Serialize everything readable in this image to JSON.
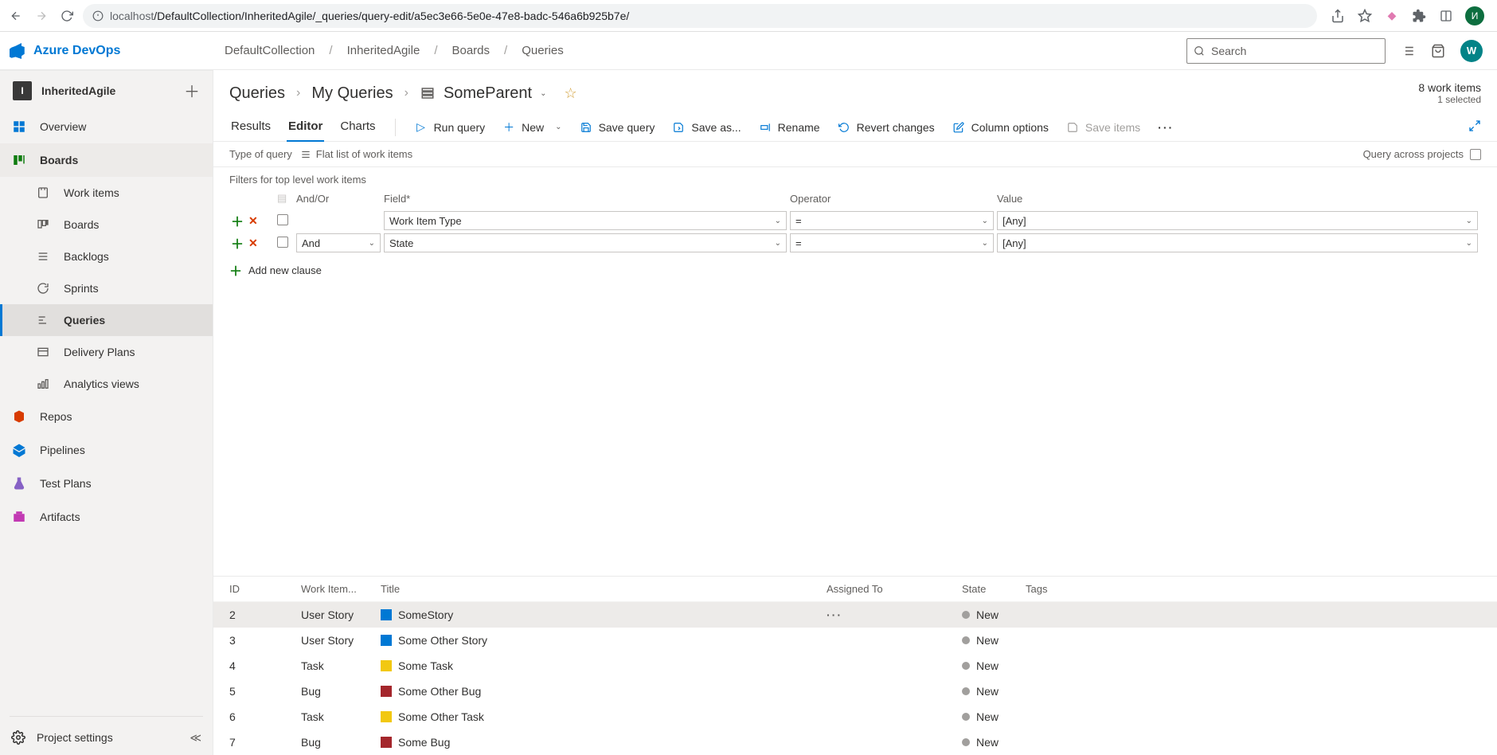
{
  "browser": {
    "url_host": "localhost",
    "url_path": "/DefaultCollection/InheritedAgile/_queries/query-edit/a5ec3e66-5e0e-47e8-badc-546a6b925b7e/",
    "avatar_initial": "И"
  },
  "suite": {
    "product": "Azure DevOps",
    "crumbs": [
      "DefaultCollection",
      "InheritedAgile",
      "Boards",
      "Queries"
    ],
    "search_placeholder": "Search",
    "avatar_initial": "W"
  },
  "sidebar": {
    "project_name": "InheritedAgile",
    "project_initial": "I",
    "items": [
      {
        "label": "Overview"
      },
      {
        "label": "Boards"
      },
      {
        "label": "Work items"
      },
      {
        "label": "Boards"
      },
      {
        "label": "Backlogs"
      },
      {
        "label": "Sprints"
      },
      {
        "label": "Queries"
      },
      {
        "label": "Delivery Plans"
      },
      {
        "label": "Analytics views"
      },
      {
        "label": "Repos"
      },
      {
        "label": "Pipelines"
      },
      {
        "label": "Test Plans"
      },
      {
        "label": "Artifacts"
      }
    ],
    "footer": "Project settings"
  },
  "query_header": {
    "bc": [
      "Queries",
      "My Queries",
      "SomeParent"
    ],
    "work_items_count": "8 work items",
    "selected_count": "1 selected"
  },
  "tabs": {
    "results": "Results",
    "editor": "Editor",
    "charts": "Charts"
  },
  "commands": {
    "run": "Run query",
    "new": "New",
    "save": "Save query",
    "saveas": "Save as...",
    "rename": "Rename",
    "revert": "Revert changes",
    "columns": "Column options",
    "saveitems": "Save items"
  },
  "query_type": {
    "label": "Type of query",
    "value": "Flat list of work items",
    "across": "Query across projects"
  },
  "filters": {
    "title": "Filters for top level work items",
    "headers": {
      "andor": "And/Or",
      "field": "Field*",
      "operator": "Operator",
      "value": "Value"
    },
    "rows": [
      {
        "andor": "",
        "field": "Work Item Type",
        "operator": "=",
        "value": "[Any]"
      },
      {
        "andor": "And",
        "field": "State",
        "operator": "=",
        "value": "[Any]"
      }
    ],
    "add": "Add new clause"
  },
  "grid": {
    "headers": {
      "id": "ID",
      "type": "Work Item...",
      "title": "Title",
      "assigned": "Assigned To",
      "state": "State",
      "tags": "Tags"
    },
    "rows": [
      {
        "id": "2",
        "type": "User Story",
        "title": "SomeStory",
        "state": "New",
        "wi": "story",
        "sel": true
      },
      {
        "id": "3",
        "type": "User Story",
        "title": "Some Other Story",
        "state": "New",
        "wi": "story"
      },
      {
        "id": "4",
        "type": "Task",
        "title": "Some Task",
        "state": "New",
        "wi": "task"
      },
      {
        "id": "5",
        "type": "Bug",
        "title": "Some Other Bug",
        "state": "New",
        "wi": "bug"
      },
      {
        "id": "6",
        "type": "Task",
        "title": "Some Other Task",
        "state": "New",
        "wi": "task"
      },
      {
        "id": "7",
        "type": "Bug",
        "title": "Some Bug",
        "state": "New",
        "wi": "bug"
      }
    ]
  }
}
